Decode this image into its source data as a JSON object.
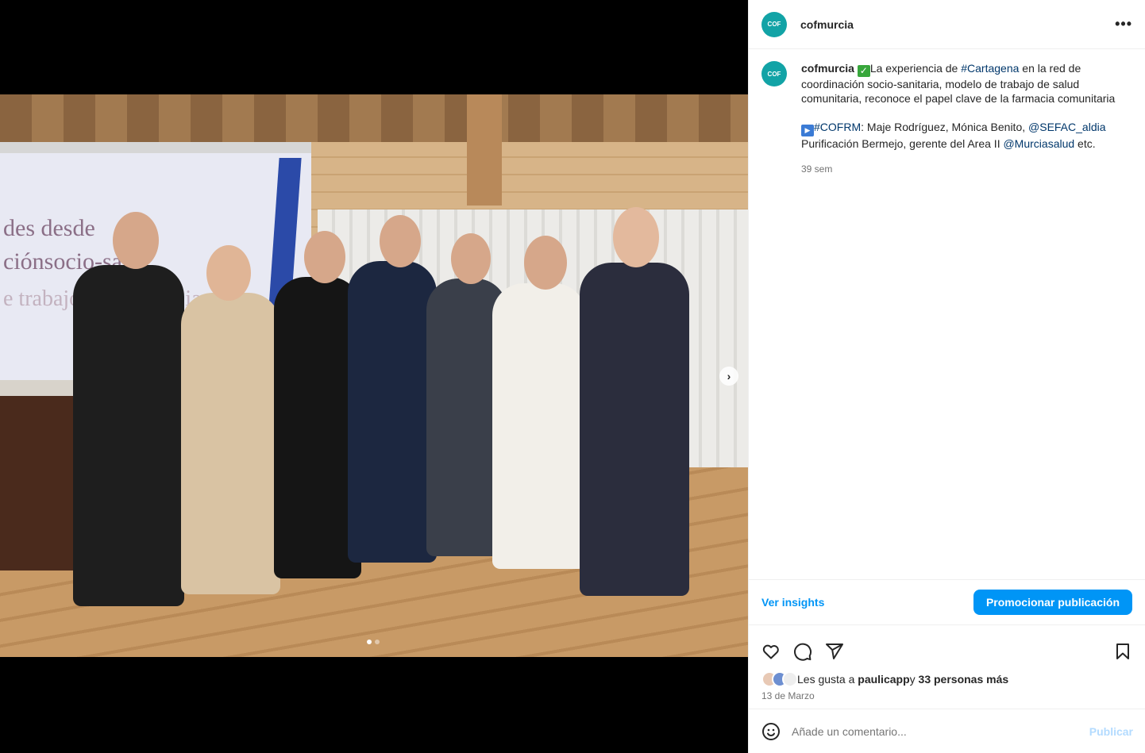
{
  "post": {
    "account": "cofmurcia",
    "avatar_text": "COF",
    "more_icon": "more-horizontal-icon",
    "caption": {
      "username": "cofmurcia",
      "check_emoji": "✓",
      "text1_a": "La experiencia de ",
      "hashtag_cartagena": "#Cartagena",
      "text1_b": " en la red de coordinación socio-sanitaria, modelo de trabajo de salud comunitaria, reconoce el papel clave de la farmacia comunitaria",
      "play_emoji": "▶",
      "hashtag_cofrm": "#COFRM",
      "text2_a": ": Maje Rodríguez, Mónica Benito, ",
      "mention_sefac": "@SEFAC_aldia",
      "text2_b": " Purificación Bermejo, gerente del Area II ",
      "mention_murcia": "@Murciasalud",
      "text2_c": " etc.",
      "time_ago": "39 sem"
    },
    "insights_label": "Ver insights",
    "promote_label": "Promocionar publicación",
    "likes": {
      "prefix": "Les gusta a ",
      "user": "paulicapp",
      "middle": " y ",
      "others": "33 personas más"
    },
    "date": "13 de Marzo",
    "comment_placeholder": "Añade un comentario...",
    "publish_label": "Publicar"
  },
  "media": {
    "screen_line1": "des desde",
    "screen_line2": "ciónsocio-sa   ia:",
    "screen_line3": "e trabajo para l   com   ia",
    "next_label": "›",
    "slide_count": 2,
    "active_slide": 1
  },
  "colors": {
    "accent": "#0095f6",
    "brand_teal": "#12a3a6",
    "link": "#00376b"
  }
}
